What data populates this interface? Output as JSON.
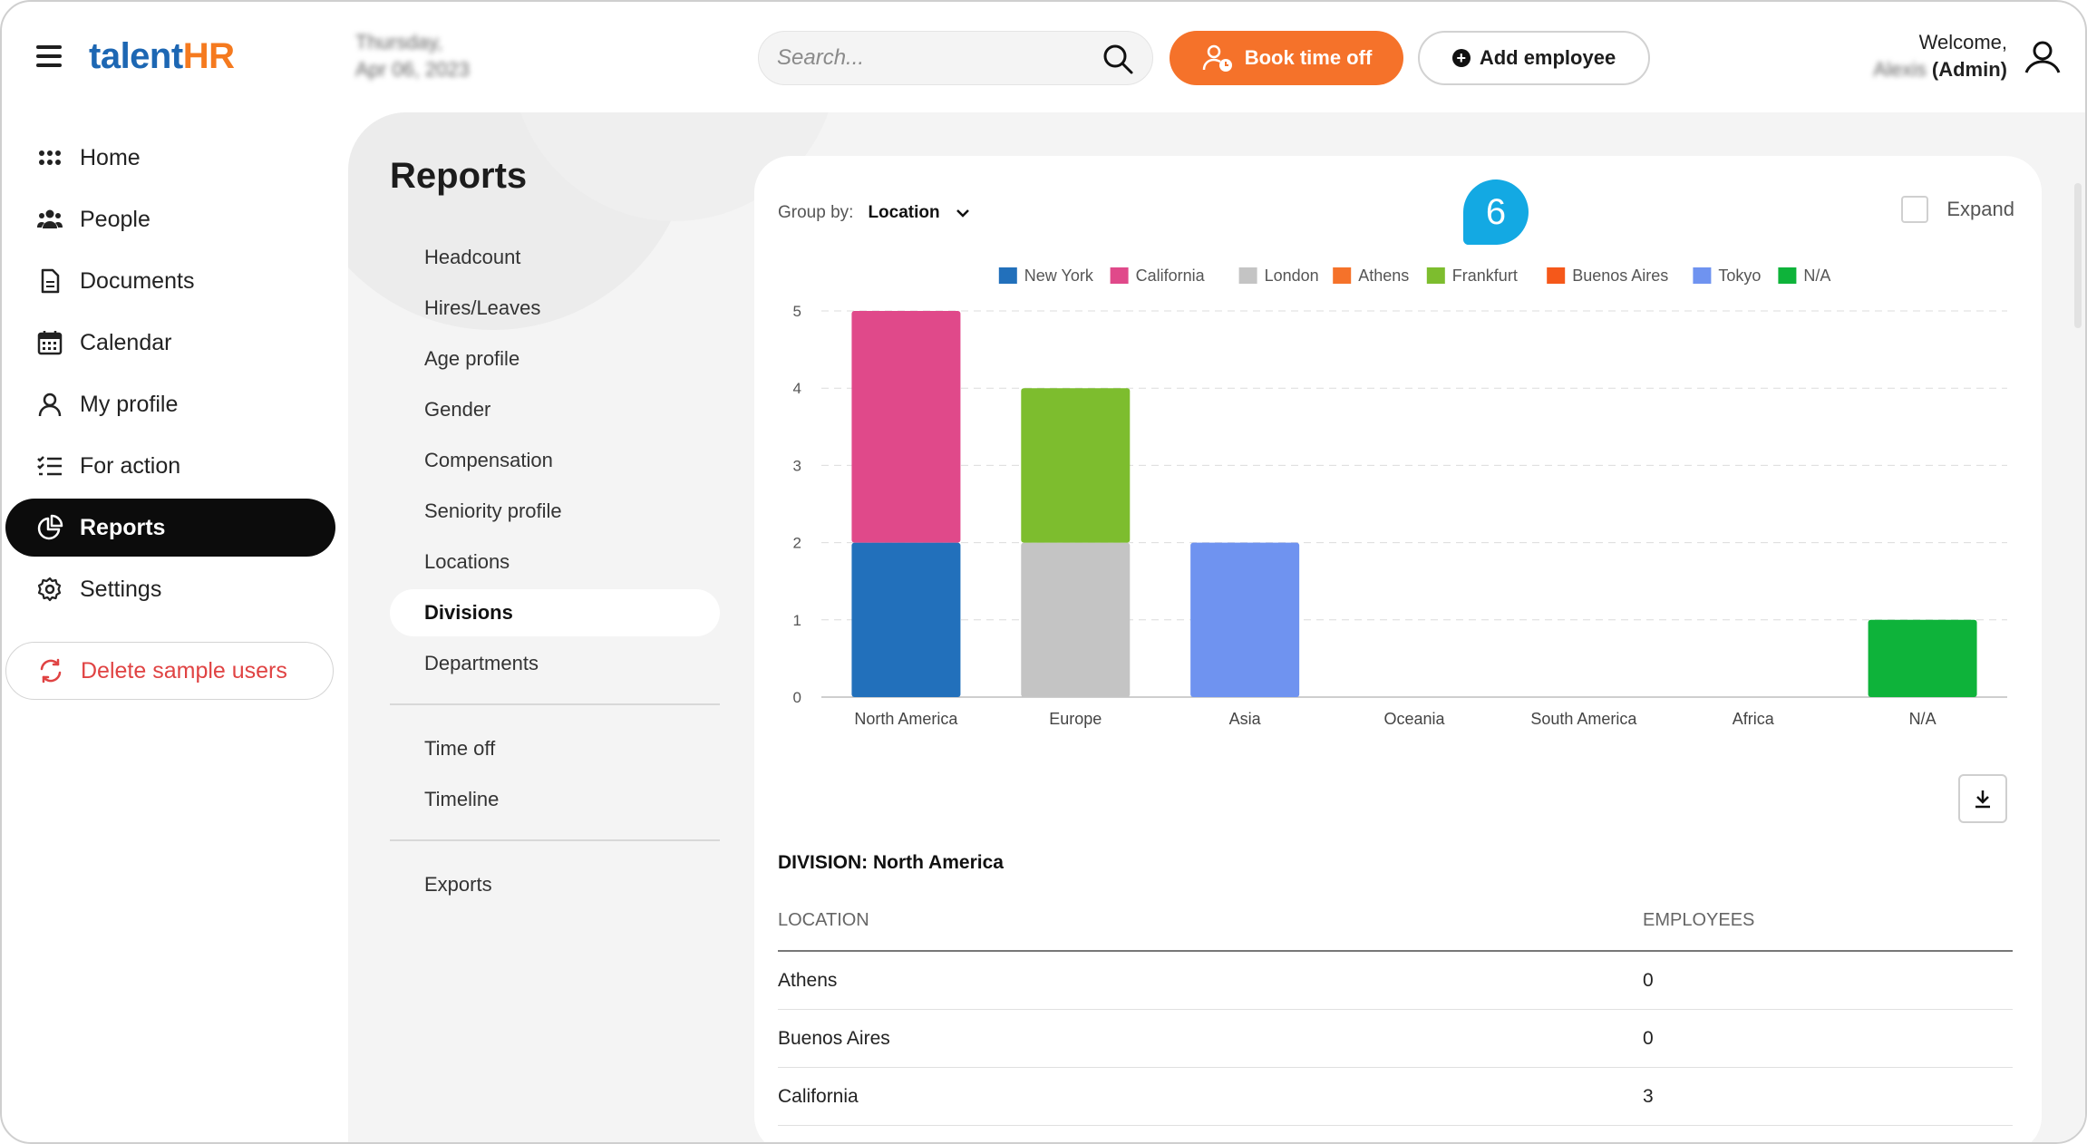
{
  "header": {
    "logo_part1": "talent",
    "logo_part2": "HR",
    "date_line1": "Thursday,",
    "date_line2": "Apr 06, 2023",
    "search_placeholder": "Search...",
    "book_label": "Book time off",
    "add_label": "Add employee",
    "welcome": "Welcome,",
    "user_name": "Alexis",
    "role": "(Admin)"
  },
  "sidebar": {
    "items": [
      {
        "label": "Home",
        "icon": "grid-dots-icon"
      },
      {
        "label": "People",
        "icon": "people-icon"
      },
      {
        "label": "Documents",
        "icon": "document-icon"
      },
      {
        "label": "Calendar",
        "icon": "calendar-icon"
      },
      {
        "label": "My profile",
        "icon": "user-icon"
      },
      {
        "label": "For action",
        "icon": "checklist-icon"
      },
      {
        "label": "Reports",
        "icon": "pie-chart-icon",
        "active": true
      },
      {
        "label": "Settings",
        "icon": "gear-icon"
      }
    ],
    "delete_label": "Delete sample users"
  },
  "reports": {
    "title": "Reports",
    "menu": [
      "Headcount",
      "Hires/Leaves",
      "Age profile",
      "Gender",
      "Compensation",
      "Seniority profile",
      "Locations",
      "Divisions",
      "Departments"
    ],
    "menu2": [
      "Time off",
      "Timeline"
    ],
    "menu3": [
      "Exports"
    ],
    "active": "Divisions"
  },
  "controls": {
    "group_by_label": "Group by:",
    "group_by_value": "Location",
    "expand_label": "Expand",
    "callout_number": "6"
  },
  "chart_data": {
    "type": "bar",
    "stacked": true,
    "categories": [
      "North America",
      "Europe",
      "Asia",
      "Oceania",
      "South America",
      "Africa",
      "N/A"
    ],
    "ylim": [
      0,
      5
    ],
    "yticks": [
      0,
      1,
      2,
      3,
      4,
      5
    ],
    "legend_position": "top",
    "grid": "dashed-horizontal",
    "series": [
      {
        "name": "New York",
        "color": "#2270bb",
        "values": [
          2,
          0,
          0,
          0,
          0,
          0,
          0
        ]
      },
      {
        "name": "California",
        "color": "#e0498a",
        "values": [
          3,
          0,
          0,
          0,
          0,
          0,
          0
        ]
      },
      {
        "name": "London",
        "color": "#c4c4c4",
        "values": [
          0,
          2,
          0,
          0,
          0,
          0,
          0
        ]
      },
      {
        "name": "Athens",
        "color": "#f5722a",
        "values": [
          0,
          0,
          0,
          0,
          0,
          0,
          0
        ]
      },
      {
        "name": "Frankfurt",
        "color": "#7dbd2e",
        "values": [
          0,
          2,
          0,
          0,
          0,
          0,
          0
        ]
      },
      {
        "name": "Buenos Aires",
        "color": "#f5581a",
        "values": [
          0,
          0,
          0,
          0,
          0,
          0,
          0
        ]
      },
      {
        "name": "Tokyo",
        "color": "#6f93f0",
        "values": [
          0,
          0,
          2,
          0,
          0,
          0,
          0
        ]
      },
      {
        "name": "N/A",
        "color": "#0eb33a",
        "values": [
          0,
          0,
          0,
          0,
          0,
          0,
          1
        ]
      }
    ]
  },
  "division": {
    "title": "DIVISION: North America",
    "col_location": "LOCATION",
    "col_employees": "EMPLOYEES",
    "rows": [
      {
        "location": "Athens",
        "employees": "0"
      },
      {
        "location": "Buenos Aires",
        "employees": "0"
      },
      {
        "location": "California",
        "employees": "3"
      }
    ]
  }
}
